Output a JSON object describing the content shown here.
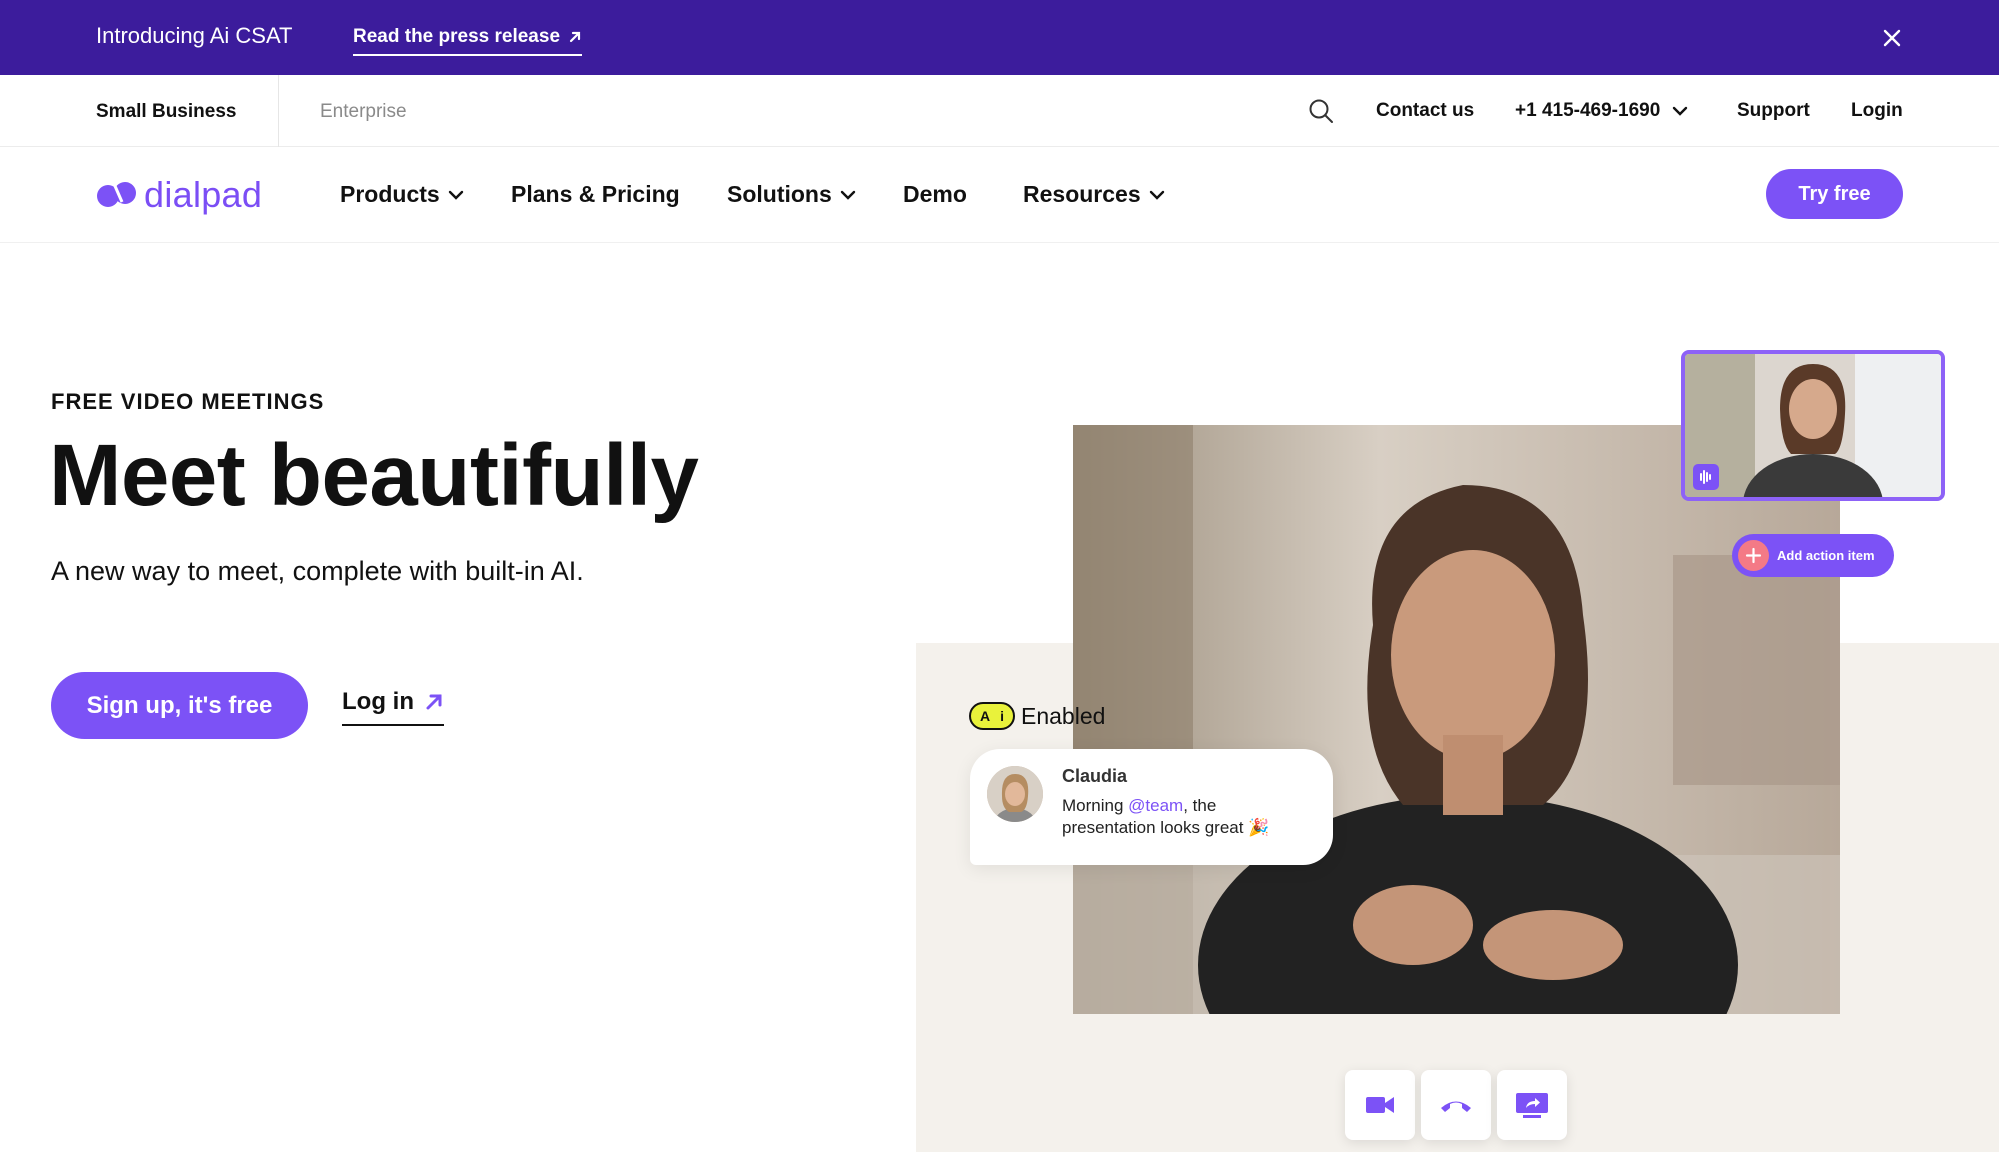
{
  "announcement": {
    "intro": "Introducing Ai CSAT",
    "link": "Read the press release"
  },
  "utility": {
    "small_business": "Small Business",
    "enterprise": "Enterprise",
    "contact": "Contact us",
    "phone": "+1 415-469-1690",
    "support": "Support",
    "login": "Login"
  },
  "nav": {
    "logo_text": "dialpad",
    "items": [
      "Products",
      "Plans & Pricing",
      "Solutions",
      "Demo",
      "Resources"
    ],
    "cta": "Try free"
  },
  "hero": {
    "eyebrow": "FREE VIDEO MEETINGS",
    "headline": "Meet beautifully",
    "subheading": "A new way to meet, complete with built-in AI.",
    "primary_cta": "Sign up, it's free",
    "secondary_cta": "Log in"
  },
  "visual": {
    "ai_badge_letters": [
      "A",
      "i"
    ],
    "ai_label": "Enabled",
    "chat": {
      "name": "Claudia",
      "msg_before": "Morning ",
      "mention": "@team",
      "msg_after": ", the presentation looks great 🎉"
    },
    "action_item": "Add action item"
  },
  "colors": {
    "brand_purple": "#7c52f6",
    "banner_purple": "#3c1c9c",
    "beige": "#f4f1ec"
  },
  "icons": {
    "close": "close-icon",
    "search": "search-icon",
    "arrow": "arrow-up-right-icon",
    "chevron": "chevron-down-icon",
    "video": "video-camera-icon",
    "hangup": "hang-up-icon",
    "share": "screen-share-icon",
    "audio": "audio-wave-icon",
    "plus": "plus-icon"
  }
}
